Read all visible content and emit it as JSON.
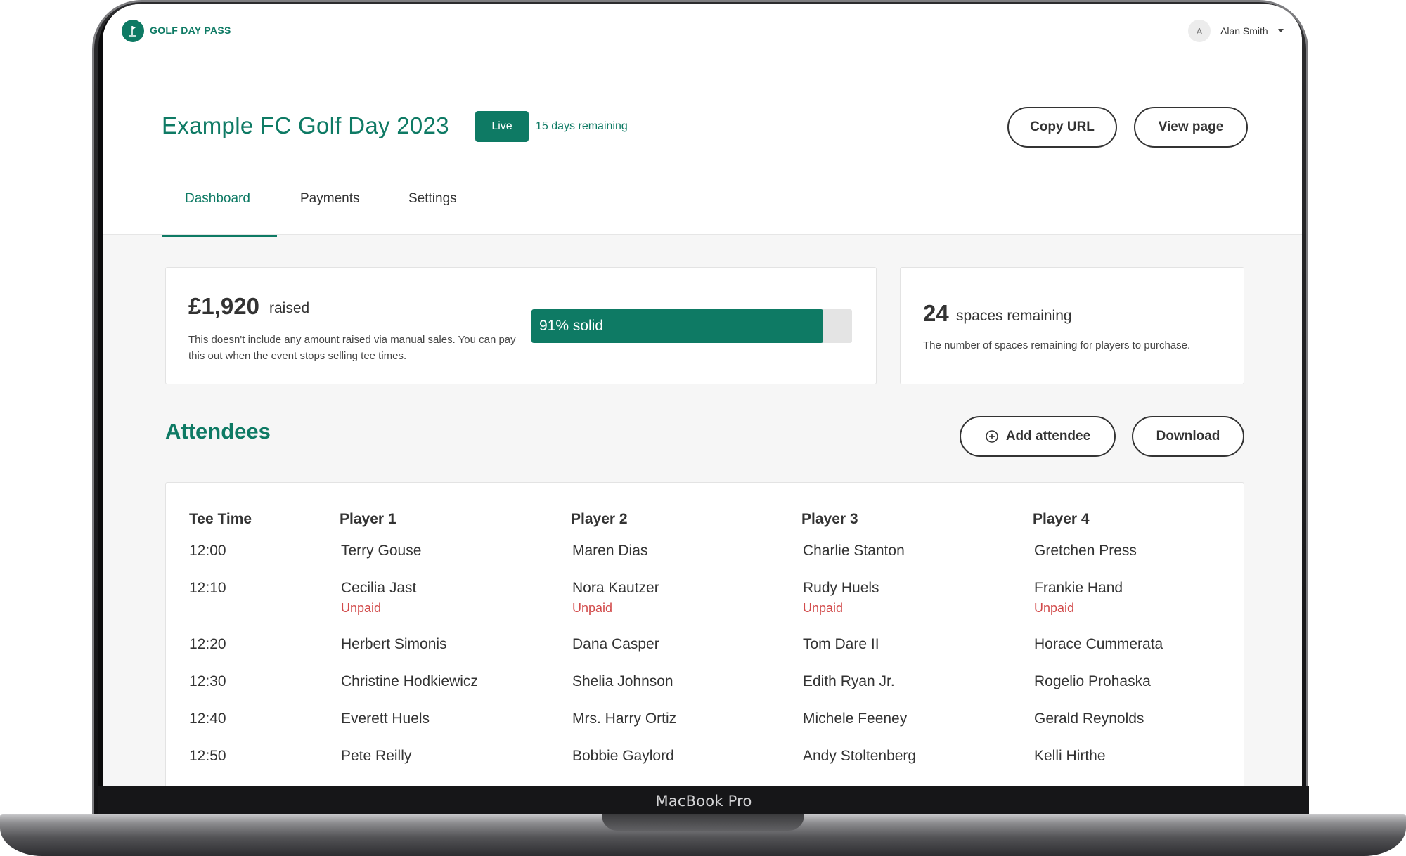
{
  "device_label": "MacBook Pro",
  "app": {
    "brand": "GOLF DAY PASS",
    "user": {
      "initial": "A",
      "name": "Alan Smith"
    }
  },
  "event": {
    "title": "Example FC Golf Day 2023",
    "status": "Live",
    "days_remaining": "15 days remaining",
    "copy_url_label": "Copy URL",
    "view_page_label": "View page"
  },
  "tabs": [
    {
      "label": "Dashboard",
      "active": true
    },
    {
      "label": "Payments",
      "active": false
    },
    {
      "label": "Settings",
      "active": false
    }
  ],
  "raised": {
    "amount": "£1,920",
    "label": "raised",
    "description": "This doesn't include any amount raised via manual sales. You can pay this out when the event stops selling tee times.",
    "progress_percent": 91,
    "progress_label": "91% solid"
  },
  "spaces": {
    "count": "24",
    "label": "spaces remaining",
    "description": "The number of spaces remaining for players to purchase."
  },
  "attendees": {
    "title": "Attendees",
    "add_label": "Add attendee",
    "download_label": "Download",
    "columns": [
      "Tee Time",
      "Player 1",
      "Player 2",
      "Player 3",
      "Player 4"
    ],
    "unpaid_label": "Unpaid",
    "rows": [
      {
        "time": "12:00",
        "players": [
          "Terry Gouse",
          "Maren Dias",
          "Charlie Stanton",
          "Gretchen Press"
        ],
        "unpaid": false
      },
      {
        "time": "12:10",
        "players": [
          "Cecilia Jast",
          "Nora Kautzer",
          "Rudy Huels",
          "Frankie Hand"
        ],
        "unpaid": true
      },
      {
        "time": "12:20",
        "players": [
          "Herbert Simonis",
          "Dana Casper",
          "Tom Dare II",
          "Horace Cummerata"
        ],
        "unpaid": false
      },
      {
        "time": "12:30",
        "players": [
          "Christine Hodkiewicz",
          "Shelia Johnson",
          "Edith Ryan Jr.",
          "Rogelio Prohaska"
        ],
        "unpaid": false
      },
      {
        "time": "12:40",
        "players": [
          "Everett Huels",
          "Mrs. Harry Ortiz",
          "Michele Feeney",
          "Gerald Reynolds"
        ],
        "unpaid": false
      },
      {
        "time": "12:50",
        "players": [
          "Pete Reilly",
          "Bobbie Gaylord",
          "Andy Stoltenberg",
          "Kelli Hirthe"
        ],
        "unpaid": false
      }
    ]
  },
  "colors": {
    "accent": "#0e7a64",
    "unpaid": "#d24c4c",
    "track": "#e4e4e4"
  }
}
